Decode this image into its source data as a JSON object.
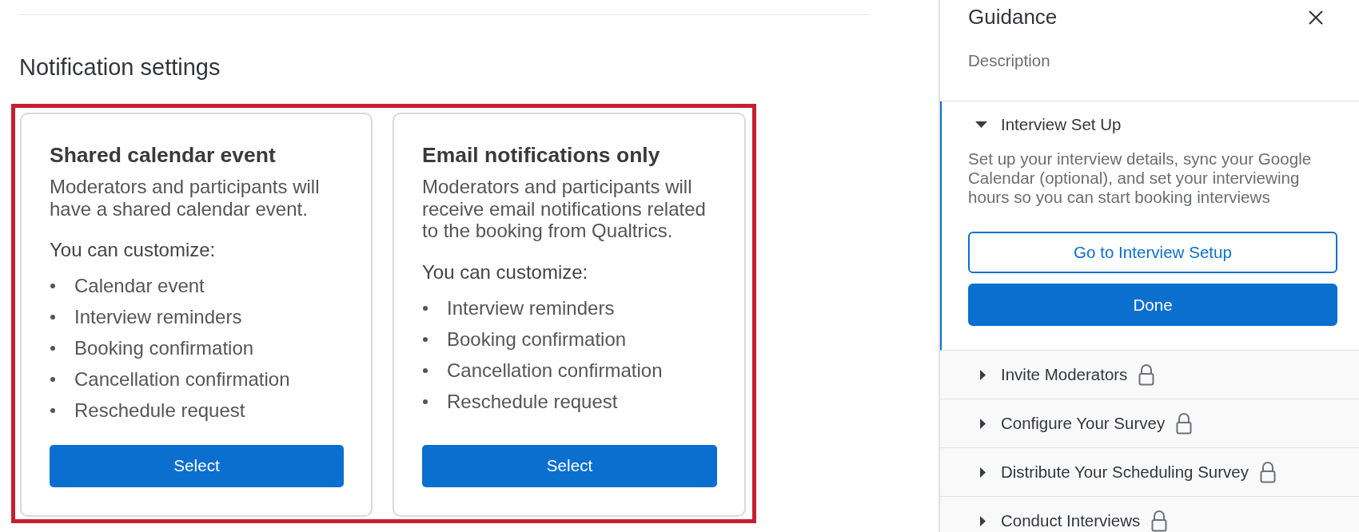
{
  "main": {
    "section_title": "Notification settings",
    "options": [
      {
        "title": "Shared calendar event",
        "description": "Moderators and participants will have a shared calendar event.",
        "customize_label": "You can customize:",
        "features": [
          "Calendar event",
          "Interview reminders",
          "Booking confirmation",
          "Cancellation confirmation",
          "Reschedule request"
        ],
        "button": "Select"
      },
      {
        "title": "Email notifications only",
        "description": "Moderators and participants will receive email notifications related to the booking from Qualtrics.",
        "customize_label": "You can customize:",
        "features": [
          "Interview reminders",
          "Booking confirmation",
          "Cancellation confirmation",
          "Reschedule request"
        ],
        "button": "Select"
      }
    ]
  },
  "guidance": {
    "title": "Guidance",
    "subtitle": "Description",
    "steps": [
      {
        "title": "Interview Set Up",
        "expanded": true,
        "locked": false,
        "description": "Set up your interview details, sync your Google Calendar (optional), and set your interviewing hours so you can start booking interviews",
        "buttons": [
          {
            "label": "Go to Interview Setup",
            "kind": "secondary"
          },
          {
            "label": "Done",
            "kind": "primary"
          }
        ]
      },
      {
        "title": "Invite Moderators",
        "expanded": false,
        "locked": true
      },
      {
        "title": "Configure Your Survey",
        "expanded": false,
        "locked": true
      },
      {
        "title": "Distribute Your Scheduling Survey",
        "expanded": false,
        "locked": true
      },
      {
        "title": "Conduct Interviews",
        "expanded": false,
        "locked": true
      }
    ]
  }
}
